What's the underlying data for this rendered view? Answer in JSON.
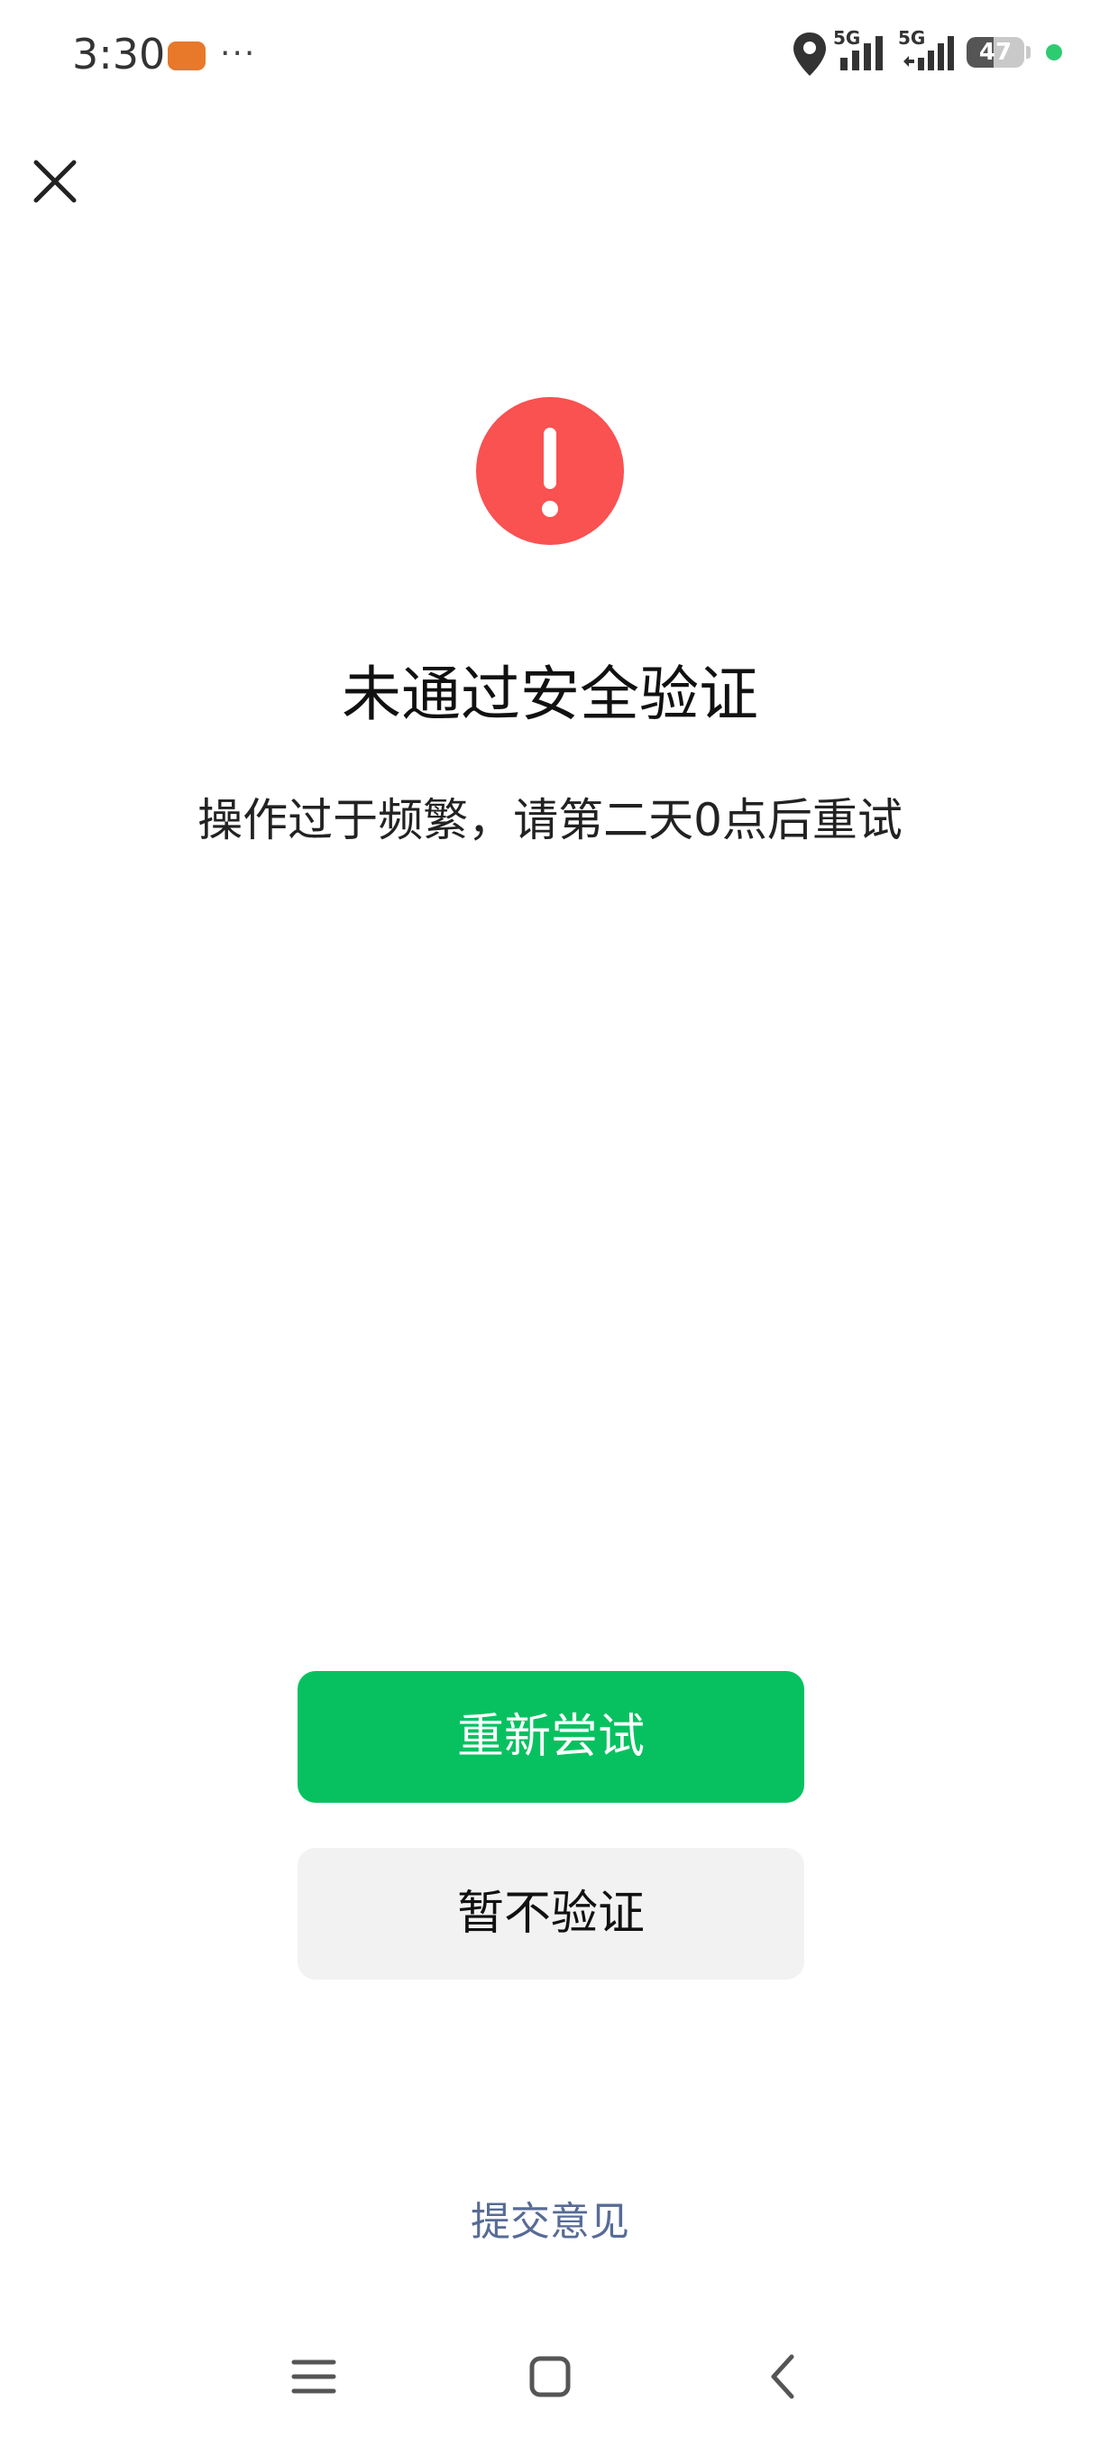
{
  "status_bar": {
    "time": "3:30",
    "app_badge": "app",
    "more": "···",
    "network_1": "5G",
    "network_2": "5G",
    "battery_level": "47",
    "battery_fraction": 0.47,
    "battery_color": "#555555",
    "dot_color": "#2ecc71"
  },
  "header": {
    "close_icon": "close-icon"
  },
  "alert": {
    "icon": "exclamation-icon",
    "color": "#fa5151"
  },
  "content": {
    "title": "未通过安全验证",
    "message": "操作过于频繁，请第二天0点后重试"
  },
  "actions": {
    "retry_label": "重新尝试",
    "skip_label": "暂不验证",
    "primary_color": "#07c160"
  },
  "footer": {
    "feedback_label": "提交意见",
    "link_color": "#576b95"
  },
  "nav_bar": {
    "menu_icon": "menu-icon",
    "home_icon": "home-icon",
    "back_icon": "back-icon"
  }
}
